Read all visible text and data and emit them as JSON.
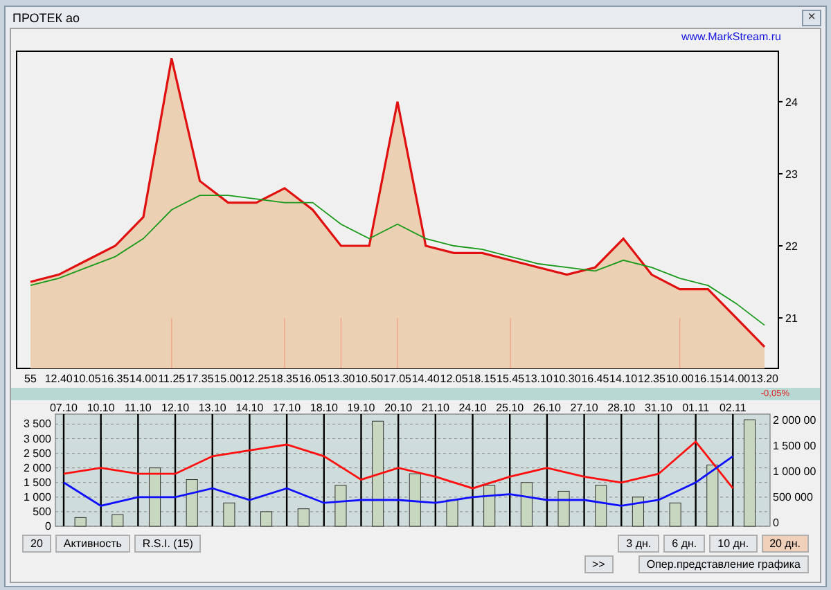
{
  "window": {
    "title": "ПРОТЕК ао",
    "close": "×"
  },
  "link": "www.MarkStream.ru",
  "price_chart": {
    "chart_data": {
      "type": "area",
      "ylim": [
        20.3,
        24.7
      ],
      "yticks": [
        21,
        22,
        23,
        24
      ],
      "categories": [
        "55",
        "12.40",
        "10.05",
        "16.35",
        "14.00",
        "11.25",
        "17.35",
        "15.00",
        "12.25",
        "18.35",
        "16.05",
        "13.30",
        "10.50",
        "17.05",
        "14.40",
        "12.05",
        "18.15",
        "15.45",
        "13.10",
        "10.30",
        "16.45",
        "14.10",
        "12.35",
        "10.00",
        "16.15",
        "14.00",
        "13.20"
      ],
      "series": [
        {
          "type": "area",
          "color": "#e01010",
          "values": [
            21.5,
            21.6,
            21.8,
            22.0,
            22.4,
            24.6,
            22.9,
            22.6,
            22.6,
            22.8,
            22.5,
            22.0,
            22.0,
            24.0,
            22.0,
            21.9,
            21.9,
            21.8,
            21.7,
            21.6,
            21.7,
            22.1,
            21.6,
            21.4,
            21.4,
            21.0,
            20.6
          ]
        },
        {
          "type": "line",
          "color": "#1a9a1a",
          "values": [
            21.45,
            21.55,
            21.7,
            21.85,
            22.1,
            22.5,
            22.7,
            22.7,
            22.65,
            22.6,
            22.6,
            22.3,
            22.1,
            22.3,
            22.1,
            22.0,
            21.95,
            21.85,
            21.75,
            21.7,
            21.65,
            21.8,
            21.7,
            21.55,
            21.45,
            21.2,
            20.9
          ]
        }
      ]
    }
  },
  "change": "-0,05%",
  "volume_chart": {
    "chart_data": {
      "type": "line",
      "grid": true,
      "ylim": [
        0,
        3700
      ],
      "yticks": [
        {
          "value": 0,
          "label": "0"
        },
        {
          "value": 500,
          "label": "500"
        },
        {
          "value": 1000,
          "label": "1 000"
        },
        {
          "value": 1500,
          "label": "1 500"
        },
        {
          "value": 2000,
          "label": "2 000"
        },
        {
          "value": 2500,
          "label": "2 500"
        },
        {
          "value": 3000,
          "label": "3 000"
        },
        {
          "value": 3500,
          "label": "3 500"
        }
      ],
      "categories": [
        "07.10",
        "10.10",
        "11.10",
        "12.10",
        "13.10",
        "14.10",
        "17.10",
        "18.10",
        "19.10",
        "20.10",
        "21.10",
        "24.10",
        "25.10",
        "26.10",
        "27.10",
        "28.10",
        "31.10",
        "01.11",
        "02.11"
      ],
      "series": [
        {
          "type": "bar",
          "color": "#c8d8c0",
          "values": [
            300,
            400,
            2000,
            1600,
            800,
            500,
            600,
            1400,
            3600,
            1800,
            900,
            1400,
            1500,
            1200,
            1400,
            1000,
            800,
            2100,
            3650
          ]
        },
        {
          "type": "line",
          "color": "#ff1010",
          "values": [
            1800,
            2000,
            1800,
            1800,
            2400,
            2600,
            2800,
            2400,
            1600,
            2000,
            1700,
            1300,
            1700,
            2000,
            1700,
            1500,
            1800,
            2900,
            1300
          ]
        },
        {
          "type": "line",
          "color": "#1010ff",
          "values": [
            1500,
            700,
            1000,
            1000,
            1300,
            900,
            1300,
            800,
            900,
            900,
            800,
            1000,
            1100,
            900,
            900,
            700,
            900,
            1500,
            2400
          ]
        }
      ]
    },
    "right_axis": [
      "2 000 00",
      "1 500 00",
      "1 000 00",
      "500 000",
      "0"
    ]
  },
  "buttons": [
    {
      "label": "20"
    },
    {
      "label": "Активность"
    },
    {
      "label": "R.S.I. (15)"
    }
  ],
  "periods": [
    {
      "label": "3 дн.",
      "selected": false
    },
    {
      "label": "6 дн.",
      "selected": false
    },
    {
      "label": "10 дн.",
      "selected": false
    },
    {
      "label": "20 дн.",
      "selected": true
    }
  ],
  "next": ">>",
  "mode_button": "Опер.представление графика"
}
